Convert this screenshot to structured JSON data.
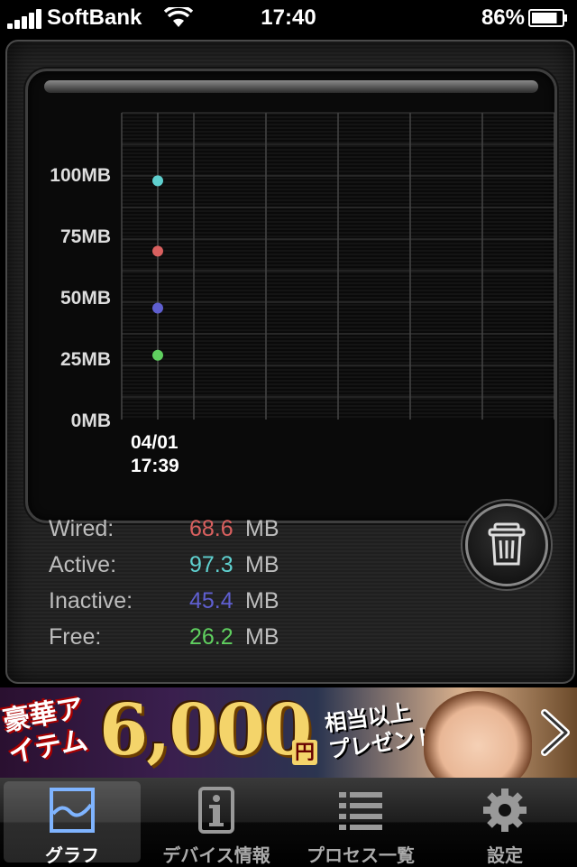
{
  "status_bar": {
    "carrier": "SoftBank",
    "time": "17:40",
    "battery": "86%"
  },
  "chart_data": {
    "type": "scatter",
    "y_tick_labels": [
      "100MB",
      "75MB",
      "50MB",
      "25MB",
      "0MB"
    ],
    "ylim": [
      0,
      125
    ],
    "x_labels": [
      {
        "date": "04/01",
        "time": "17:39"
      }
    ],
    "grid": true,
    "series": [
      {
        "name": "Wired",
        "color": "#d9605f",
        "values": [
          68.6
        ]
      },
      {
        "name": "Active",
        "color": "#5fd0cf",
        "values": [
          97.3
        ]
      },
      {
        "name": "Inactive",
        "color": "#5f5fd0",
        "values": [
          45.4
        ]
      },
      {
        "name": "Free",
        "color": "#5fcf5f",
        "values": [
          26.2
        ]
      }
    ]
  },
  "stats": [
    {
      "label": "Wired:",
      "value": "68.6",
      "unit": "MB",
      "color": "#d9605f"
    },
    {
      "label": "Active:",
      "value": "97.3",
      "unit": "MB",
      "color": "#5fd0cf"
    },
    {
      "label": "Inactive:",
      "value": "45.4",
      "unit": "MB",
      "color": "#5f5fd0"
    },
    {
      "label": "Free:",
      "value": "26.2",
      "unit": "MB",
      "color": "#5fcf5f"
    }
  ],
  "trash_icon": "trash-icon",
  "banner": {
    "text_left": "豪華アイテム",
    "amount": "6,000",
    "yen": "円",
    "text_right_1": "相当以上",
    "text_right_2": "プレゼント"
  },
  "tabs": [
    {
      "label": "グラフ",
      "icon": "graph-icon",
      "active": true
    },
    {
      "label": "デバイス情報",
      "icon": "info-icon",
      "active": false
    },
    {
      "label": "プロセス一覧",
      "icon": "list-icon",
      "active": false
    },
    {
      "label": "設定",
      "icon": "gear-icon",
      "active": false
    }
  ]
}
